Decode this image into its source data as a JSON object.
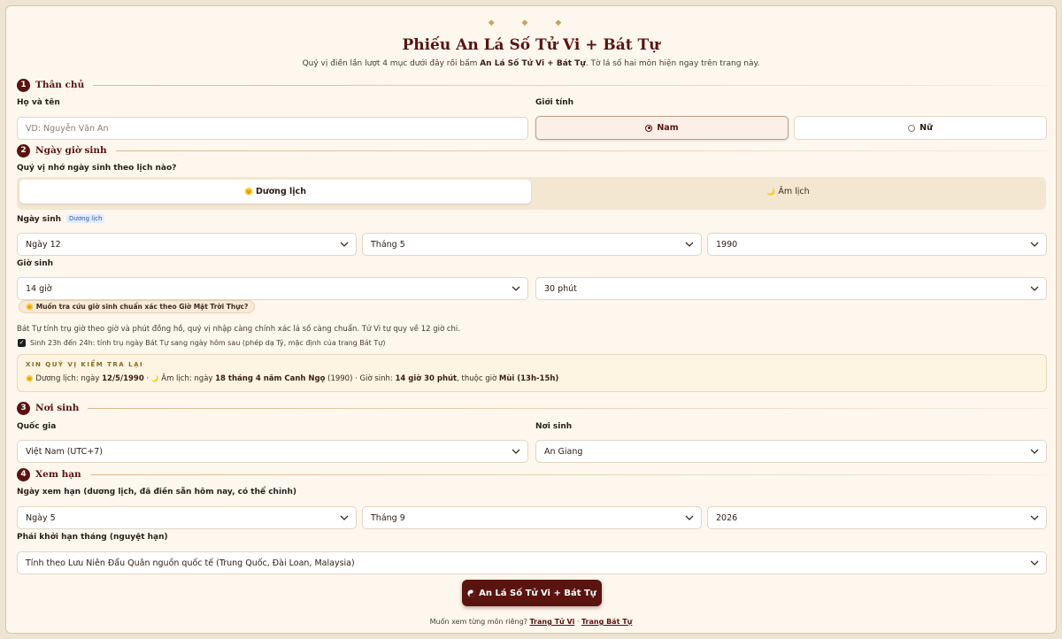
{
  "header": {
    "ornament": "◆ ◆ ◆",
    "title": "Phiếu An Lá Số Tử Vi + Bát Tự",
    "subtitle_before": "Quý vị điền lần lượt 4 mục dưới đây rồi bấm ",
    "subtitle_bold": "An Lá Số Tử Vi + Bát Tự",
    "subtitle_after": ". Tờ lá số hai môn hiện ngay trên trang này."
  },
  "section1": {
    "number": "1",
    "title": "Thân chủ",
    "name_label": "Họ và tên",
    "name_placeholder": "VD: Nguyễn Văn An",
    "gender_label": "Giới tính",
    "gender_male": "Nam",
    "gender_female": "Nữ"
  },
  "section2": {
    "number": "2",
    "title": "Ngày giờ sinh",
    "calendar_question": "Quý vị nhớ ngày sinh theo lịch nào?",
    "solar_label": "Dương lịch",
    "lunar_label": "Âm lịch",
    "solar_icon": "🌞",
    "lunar_icon": "🌙",
    "dob_label": "Ngày sinh",
    "dob_tag": "Dương lịch",
    "day": "Ngày 12",
    "month": "Tháng 5",
    "year": "1990",
    "time_label": "Giờ sinh",
    "hour": "14 giờ",
    "minute": "30 phút",
    "solar_time_pill": "Muốn tra cứu giờ sinh chuẩn xác theo Giờ Mặt Trời Thực?",
    "note": "Bát Tự tính trụ giờ theo giờ và phút đồng hồ, quý vị nhập càng chính xác lá số càng chuẩn. Tử Vi tự quy về 12 giờ chi.",
    "checkbox_label": "Sinh 23h đến 24h: tính trụ ngày Bát Tự sang ngày hôm sau (phép dạ Tý, mặc định của trang Bát Tự)",
    "checkbox_checked": true,
    "confirm_heading": "XIN QUÝ VỊ KIỂM TRA LẠI",
    "confirm_solar_prefix": "Dương lịch: ngày ",
    "confirm_solar_value": "12/5/1990",
    "confirm_lunar_prefix": "Âm lịch: ngày ",
    "confirm_lunar_value": "18 tháng 4 năm Canh Ngọ",
    "confirm_lunar_year": " (1990)",
    "confirm_time_prefix": "Giờ sinh: ",
    "confirm_time_value": "14 giờ 30 phút",
    "confirm_time_mid": ", thuộc giờ ",
    "confirm_time_branch": "Mùi (13h-15h)",
    "sep": " · "
  },
  "section3": {
    "number": "3",
    "title": "Nơi sinh",
    "country_label": "Quốc gia",
    "country": "Việt Nam (UTC+7)",
    "place_label": "Nơi sinh",
    "place": "An Giang"
  },
  "section4": {
    "number": "4",
    "title": "Xem hạn",
    "date_label": "Ngày xem hạn (dương lịch, đã điền sẵn hôm nay, có thể chỉnh)",
    "day": "Ngày 5",
    "month": "Tháng 9",
    "year": "2026",
    "school_label": "Phái khởi hạn tháng (nguyệt hạn)",
    "school": "Tính theo Lưu Niên Đẩu Quân nguồn quốc tế (Trung Quốc, Đài Loan, Malaysia)"
  },
  "submit_label": "An Lá Số Tử Vi + Bát Tự",
  "footer": {
    "prefix": "Muốn xem từng môn riêng? ",
    "link1": "Trang Tử Vi",
    "sep": " · ",
    "link2": "Trang Bát Tự"
  },
  "colors": {
    "accent": "#5a1410",
    "background": "#fdf7ee",
    "gold": "#c9a25e"
  }
}
